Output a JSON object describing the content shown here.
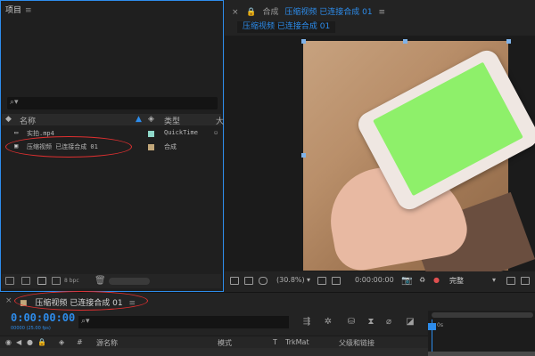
{
  "project": {
    "title": "项目",
    "search_icon": "⌕▾",
    "columns": {
      "name": "名称",
      "type": "类型",
      "more": "大"
    },
    "items": [
      {
        "name": "实拍.mp4",
        "type": "QuickTime",
        "color": "#8fd7c9"
      },
      {
        "name": "压缩视频 已连接合成 01",
        "type": "合成",
        "color": "#c2a77a"
      }
    ],
    "bpc": "8 bpc"
  },
  "comp": {
    "tab_prefix": "合成",
    "tab_name": "压缩视频 已连接合成 01",
    "subtab": "压缩视频 已连接合成 01",
    "zoom": "(30.8%)",
    "time": "0:00:00:00",
    "quality": "完整"
  },
  "timeline": {
    "title": "压缩视频 已连接合成 01",
    "timecode": "0:00:00:00",
    "timecode_sub": "00000 (25.00 fps)",
    "search_icon": "⌕▾",
    "columns": {
      "num": "#",
      "source": "源名称",
      "mode": "模式",
      "t": "T",
      "trkmat": "TrkMat",
      "parent": "父级和链接"
    },
    "ruler_label": "0s"
  }
}
